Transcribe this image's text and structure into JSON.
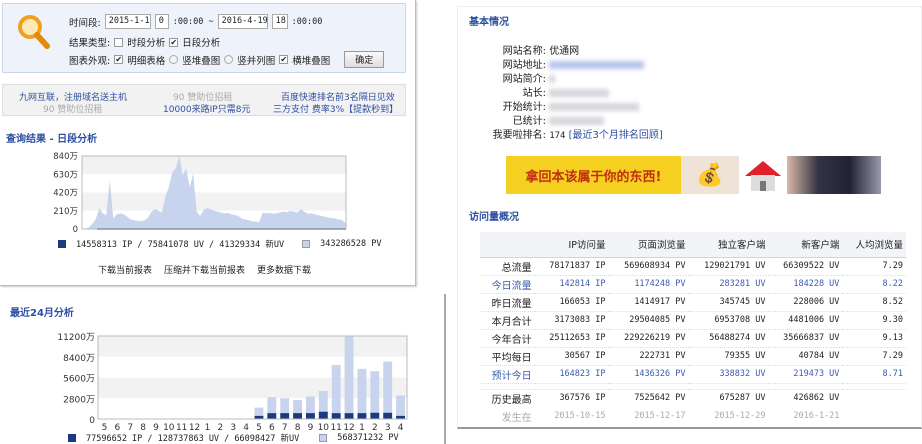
{
  "search": {
    "time_label": "时间段:",
    "start_date": "2015-1-1",
    "start_hour": "0",
    "start_rest": ":00:00 ~",
    "end_date": "2016-4-19",
    "end_hour": "18",
    "end_rest": ":00:00",
    "result_type_label": "结果类型:",
    "opt_hourly": "时段分析",
    "opt_daily": "日段分析",
    "chart_label": "图表外观:",
    "opt_table": "明细表格",
    "opt_vstack": "竖堆叠图",
    "opt_vside": "竖并列图",
    "opt_hstack": "横堆叠图",
    "confirm": "确定"
  },
  "ads": {
    "a1": "九网互联，注册域名送主机",
    "a2": "90 赞助位招租",
    "a3": "90 赞助位招租",
    "a4": "10000来路IP只需8元",
    "a5": "百度快速排名前3名隔日见效",
    "a6": "三方支付 费率3%【提款秒到】"
  },
  "daily": {
    "title": "查询结果 - 日段分析",
    "legend_ip": "14558313 IP / 75841078 UV / 41329334 新UV",
    "legend_pv": "343286528 PV",
    "links": [
      "下载当前报表",
      "压缩并下载当前报表",
      "更多数据下载"
    ]
  },
  "monthly": {
    "title": "最近24月分析",
    "legend_ip": "77596652 IP / 128737863 UV / 66098427 新UV",
    "legend_pv": "568371232 PV"
  },
  "chart_data": [
    {
      "type": "area",
      "title": "日段分析",
      "ylabel": "PV",
      "ylim": [
        0,
        840
      ],
      "yticks": [
        "840万",
        "630万",
        "420万",
        "210万",
        "0"
      ],
      "values": [
        0,
        5,
        20,
        60,
        120,
        240,
        180,
        160,
        560,
        120,
        170,
        180,
        170,
        140,
        110,
        100,
        95,
        90,
        100,
        130,
        200,
        230,
        210,
        190,
        380,
        480,
        650,
        700,
        840,
        620,
        700,
        480,
        640,
        200,
        150,
        220,
        240,
        230,
        210,
        200,
        190,
        180,
        185,
        170,
        160,
        150,
        120,
        110,
        100,
        90,
        85,
        80,
        190,
        180,
        185,
        175,
        180,
        190,
        200,
        195,
        210,
        200,
        190,
        230,
        200,
        175,
        180,
        170,
        160,
        150,
        140,
        130,
        125,
        120,
        110,
        100,
        60
      ]
    },
    {
      "type": "bar",
      "title": "最近24月分析",
      "ylim": [
        0,
        11200
      ],
      "yticks": [
        "11200万",
        "8400万",
        "5600万",
        "2800万",
        "0"
      ],
      "categories": [
        "5",
        "6",
        "7",
        "8",
        "9",
        "10",
        "11",
        "12",
        "1",
        "2",
        "3",
        "4",
        "5",
        "6",
        "7",
        "8",
        "9",
        "10",
        "11",
        "12",
        "1",
        "2",
        "3",
        "4"
      ],
      "series": [
        {
          "name": "PV",
          "values": [
            0,
            0,
            0,
            0,
            0,
            0,
            0,
            0,
            0,
            0,
            0,
            0,
            1540,
            2940,
            2800,
            2570,
            3030,
            3780,
            7280,
            11200,
            6770,
            6440,
            7750,
            3170
          ]
        },
        {
          "name": "IP",
          "values": [
            0,
            0,
            0,
            0,
            0,
            0,
            0,
            0,
            0,
            0,
            0,
            0,
            420,
            790,
            790,
            790,
            790,
            980,
            790,
            790,
            790,
            840,
            840,
            420
          ]
        }
      ]
    }
  ],
  "basic": {
    "title": "基本情况",
    "rows": [
      {
        "k": "网站名称:",
        "v": "优通网"
      },
      {
        "k": "网站地址:"
      },
      {
        "k": "网站简介:"
      },
      {
        "k": "站长:"
      },
      {
        "k": "开始统计:"
      },
      {
        "k": "已统计:"
      }
    ],
    "rank_label": "我要啦排名:",
    "rank": "174",
    "rank_link": "[最近3个月排名回顾]",
    "banner": "拿回本该属于你的东西!"
  },
  "overview": {
    "title": "访问量概况",
    "headers": [
      "",
      "IP访问量",
      "页面浏览量",
      "独立客户端",
      "新客户端",
      "人均浏览量"
    ],
    "rows": [
      [
        "总流量",
        "78171837 IP",
        "569608934 PV",
        "129021791 UV",
        "66309522 UV",
        "7.29"
      ],
      [
        "今日流量",
        "142814 IP",
        "1174248 PV",
        "283281 UV",
        "184228 UV",
        "8.22"
      ],
      [
        "昨日流量",
        "166053 IP",
        "1414917 PV",
        "345745 UV",
        "228006 UV",
        "8.52"
      ],
      [
        "本月合计",
        "3173083 IP",
        "29504085 PV",
        "6953708 UV",
        "4481006 UV",
        "9.30"
      ],
      [
        "今年合计",
        "25112653 IP",
        "229226219 PV",
        "56488274 UV",
        "35666837 UV",
        "9.13"
      ],
      [
        "平均每日",
        "30567 IP",
        "222731 PV",
        "79355 UV",
        "40784 UV",
        "7.29"
      ],
      [
        "预计今日",
        "164823 IP",
        "1436326 PV",
        "338832 UV",
        "219473 UV",
        "8.71"
      ]
    ],
    "peak": [
      "历史最高",
      "367576 IP",
      "7525642 PV",
      "675287 UV",
      "426862 UV"
    ],
    "peak_date": [
      "发生在",
      "2015-10-15",
      "2015-12-17",
      "2015-12-29",
      "2016-1-21"
    ]
  }
}
